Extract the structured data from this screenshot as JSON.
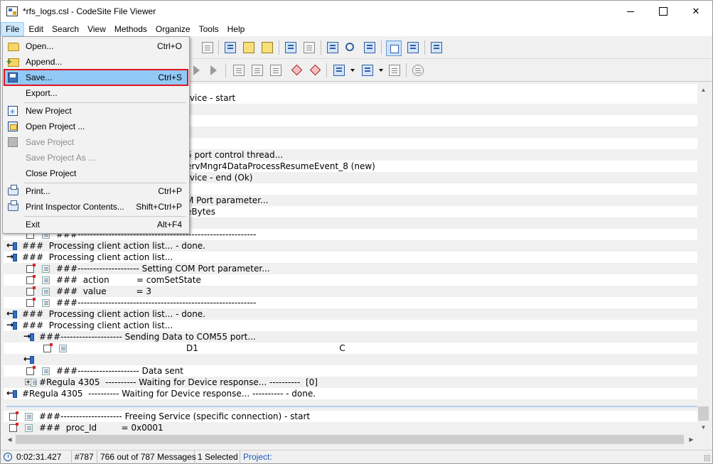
{
  "window": {
    "title": "*rfs_logs.csl - CodeSite File Viewer"
  },
  "menubar": {
    "items": [
      "File",
      "Edit",
      "Search",
      "View",
      "Methods",
      "Organize",
      "Tools",
      "Help"
    ],
    "active": "File"
  },
  "file_menu": {
    "items": [
      {
        "label": "Open...",
        "shortcut": "Ctrl+O",
        "icon": "open-folder-icon",
        "enabled": true
      },
      {
        "label": "Append...",
        "shortcut": "",
        "icon": "append-icon",
        "enabled": true
      },
      {
        "label": "Save...",
        "shortcut": "Ctrl+S",
        "icon": "save-icon",
        "enabled": true,
        "highlighted": true
      },
      {
        "label": "Export...",
        "shortcut": "",
        "icon": "",
        "enabled": true
      },
      {
        "label": "New Project",
        "shortcut": "",
        "icon": "new-project-icon",
        "enabled": true
      },
      {
        "label": "Open Project ...",
        "shortcut": "",
        "icon": "open-project-icon",
        "enabled": true
      },
      {
        "label": "Save Project",
        "shortcut": "",
        "icon": "save-project-icon",
        "enabled": false
      },
      {
        "label": "Save Project As ...",
        "shortcut": "",
        "icon": "",
        "enabled": false
      },
      {
        "label": "Close Project",
        "shortcut": "",
        "icon": "",
        "enabled": true
      },
      {
        "label": "Print...",
        "shortcut": "Ctrl+P",
        "icon": "print-icon",
        "enabled": true
      },
      {
        "label": "Print Inspector Contents...",
        "shortcut": "Shift+Ctrl+P",
        "icon": "print-inspector-icon",
        "enabled": true
      },
      {
        "label": "Exit",
        "shortcut": "Alt+F4",
        "icon": "",
        "enabled": true
      }
    ]
  },
  "log": {
    "rows": [
      {
        "text": "rvice - start"
      },
      {
        "text": ""
      },
      {
        "text": ""
      },
      {
        "text": ""
      },
      {
        "text": ""
      },
      {
        "text": "5 port control thread..."
      },
      {
        "text": "ervMngr4DataProcessResumeEvent_8 (new)"
      },
      {
        "text": "rvice - end (Ok)"
      },
      {
        "text": ""
      },
      {
        "text": "M Port parameter..."
      },
      {
        "text": "eBytes"
      },
      {
        "text": ""
      },
      {
        "text": "###----------------------------------------------------------"
      },
      {
        "text": "###  Processing client action list... - done."
      },
      {
        "text": "###  Processing client action list..."
      },
      {
        "text": "###-------------------- Setting COM Port parameter..."
      },
      {
        "text": "###  action          = comSetState"
      },
      {
        "text": "###  value           = 3"
      },
      {
        "text": "###----------------------------------------------------------"
      },
      {
        "text": "###  Processing client action list... - done."
      },
      {
        "text": "###  Processing client action list..."
      },
      {
        "text": "###-------------------- Sending Data to COM55 port..."
      },
      {
        "text": "D1                                                    C"
      },
      {
        "text": ""
      },
      {
        "text": "###-------------------- Data sent"
      },
      {
        "text": "#Regula 4305  ---------- Waiting for Device response... ----------  [0]"
      },
      {
        "text": "#Regula 4305  ---------- Waiting for Device response... ---------- - done."
      },
      {
        "text": ""
      },
      {
        "text": "###-------------------- Freeing Service (specific connection) - start"
      },
      {
        "text": "###  proc_Id         = 0x0001"
      }
    ]
  },
  "statusbar": {
    "time": "0:02:31.427",
    "message_no": "#787",
    "message_count": "766 out of 787 Messages",
    "selected": "1 Selected",
    "project": "Project:"
  }
}
